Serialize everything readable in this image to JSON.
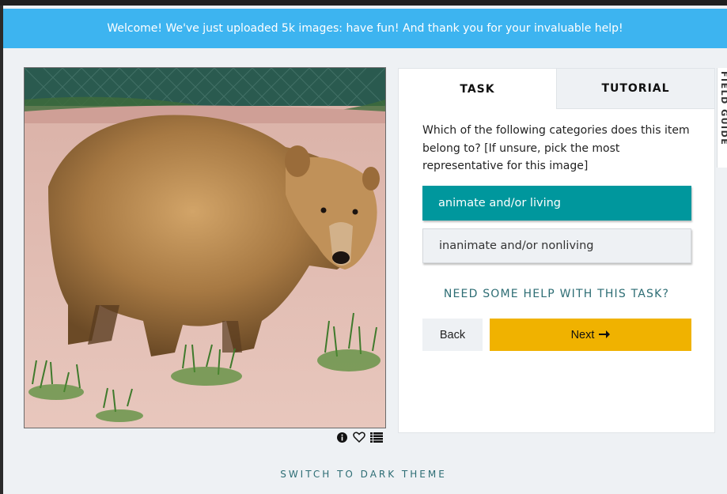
{
  "banner": {
    "text": "Welcome! We've just uploaded 5k images: have fun! And thank you for your invaluable help!"
  },
  "subject": {
    "image_description_icon": "bear-photo",
    "meta_icons": [
      "info-icon",
      "heart-icon",
      "list-icon"
    ]
  },
  "tabs": [
    {
      "label": "TASK",
      "active": true
    },
    {
      "label": "TUTORIAL",
      "active": false
    }
  ],
  "task": {
    "question": "Which of the following categories does this item belong to? [If unsure, pick the most representative for this image]",
    "answers": [
      {
        "label": "animate and/or living",
        "selected": true
      },
      {
        "label": "inanimate and/or nonliving",
        "selected": false
      }
    ],
    "help_link": "NEED SOME HELP WITH THIS TASK?",
    "back_label": "Back",
    "next_label": "Next"
  },
  "field_guide": {
    "label": "FIELD GUIDE"
  },
  "footer": {
    "theme_switch": "SWITCH TO DARK THEME"
  },
  "colors": {
    "banner": "#3db4f0",
    "selected_answer": "#00979d",
    "next_button": "#f0b200",
    "link": "#2d6d74"
  }
}
